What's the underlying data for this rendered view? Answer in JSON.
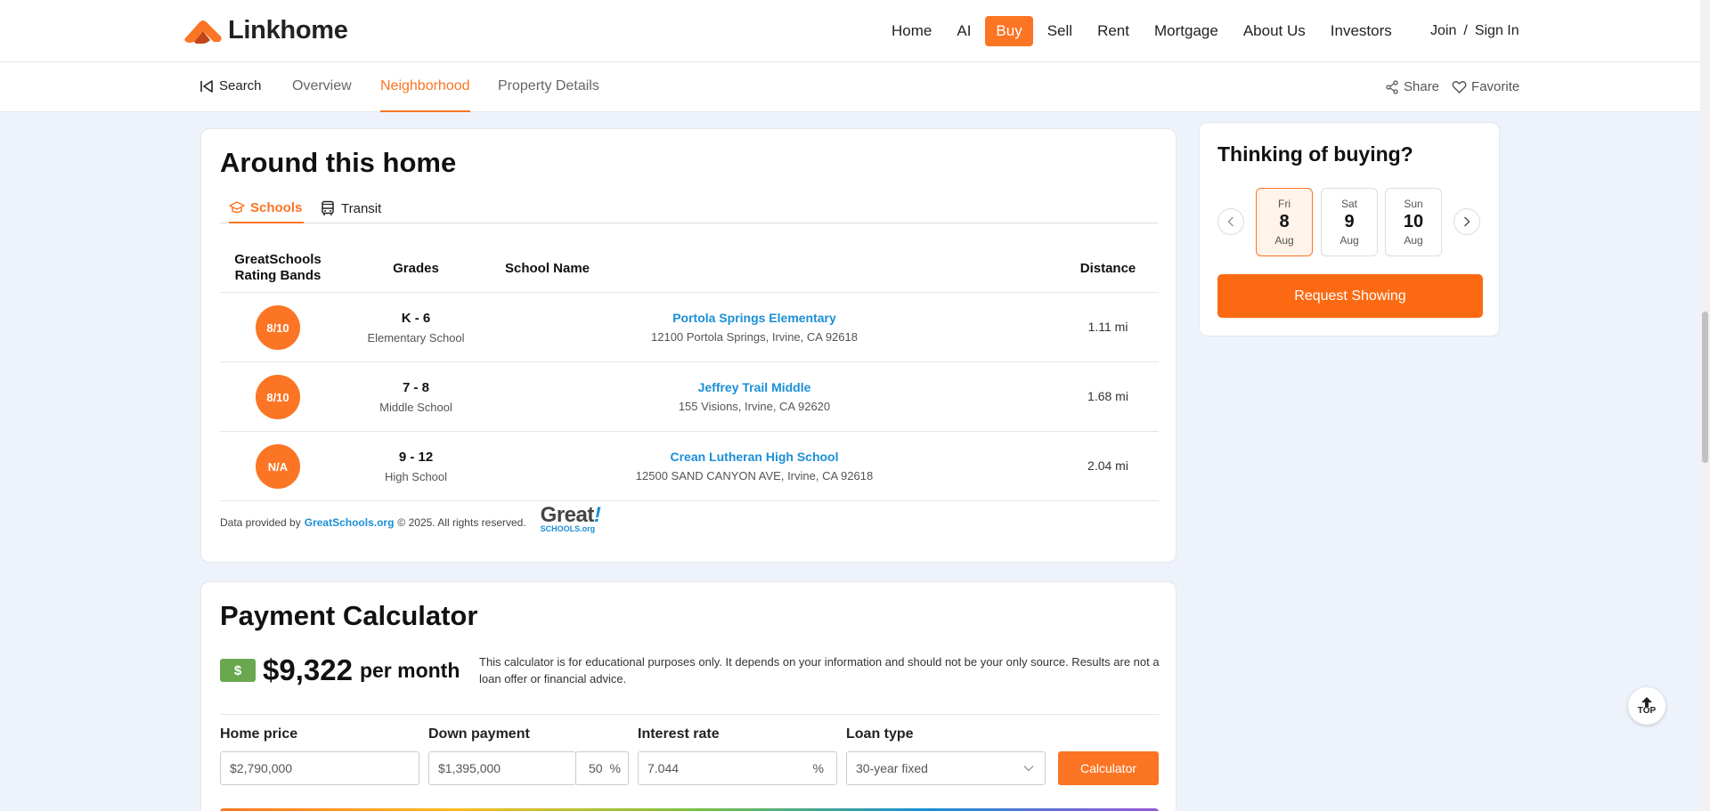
{
  "header": {
    "logo_text": "Linkhome",
    "nav": [
      "Home",
      "AI",
      "Buy",
      "Sell",
      "Rent",
      "Mortgage",
      "About Us",
      "Investors"
    ],
    "active_nav": "Buy",
    "join": "Join",
    "separator": "/",
    "sign_in": "Sign In"
  },
  "subnav": {
    "back": "Search",
    "tabs": [
      "Overview",
      "Neighborhood",
      "Property Details"
    ],
    "active_tab": "Neighborhood",
    "share": "Share",
    "favorite": "Favorite"
  },
  "around": {
    "title": "Around this home",
    "tabs": [
      "Schools",
      "Transit"
    ],
    "active_tab": "Schools",
    "columns": {
      "rating": "GreatSchools Rating Bands",
      "grades": "Grades",
      "name": "School Name",
      "distance": "Distance"
    },
    "schools": [
      {
        "rating": "8/10",
        "grades": "K - 6",
        "level": "Elementary School",
        "name": "Portola Springs Elementary",
        "address": "12100 Portola Springs, Irvine, CA 92618",
        "distance": "1.11 mi"
      },
      {
        "rating": "8/10",
        "grades": "7 - 8",
        "level": "Middle School",
        "name": "Jeffrey Trail Middle",
        "address": "155 Visions, Irvine, CA 92620",
        "distance": "1.68 mi"
      },
      {
        "rating": "N/A",
        "grades": "9 - 12",
        "level": "High School",
        "name": "Crean Lutheran High School",
        "address": "12500 SAND CANYON AVE, Irvine, CA 92618",
        "distance": "2.04 mi"
      }
    ],
    "provided_prefix": "Data provided by",
    "provided_link": "GreatSchools.org",
    "provided_suffix": "© 2025. All rights reserved.",
    "gs_logo_great": "Great",
    "gs_logo_bang": "!",
    "gs_logo_sub": "SCHOOLS.org"
  },
  "payment": {
    "title": "Payment Calculator",
    "money_icon": "$",
    "amount": "$9,322",
    "per": "per month",
    "note": "This calculator is for educational purposes only. It depends on your information and should not be your only source. Results are not a loan offer or financial advice.",
    "labels": {
      "home_price": "Home price",
      "down_payment": "Down payment",
      "interest_rate": "Interest rate",
      "loan_type": "Loan type"
    },
    "home_price": "$2,790,000",
    "down_payment": "$1,395,000",
    "down_pct": "50",
    "pct_sign": "%",
    "interest_rate": "7.044",
    "loan_type": "30-year fixed",
    "calc_button": "Calculator"
  },
  "side": {
    "title": "Thinking of buying?",
    "dates": [
      {
        "dow": "Fri",
        "day": "8",
        "mon": "Aug"
      },
      {
        "dow": "Sat",
        "day": "9",
        "mon": "Aug"
      },
      {
        "dow": "Sun",
        "day": "10",
        "mon": "Aug"
      }
    ],
    "request": "Request Showing"
  },
  "top_button": "TOP",
  "colors": {
    "accent": "#fb7524",
    "link": "#1a8fd6"
  }
}
